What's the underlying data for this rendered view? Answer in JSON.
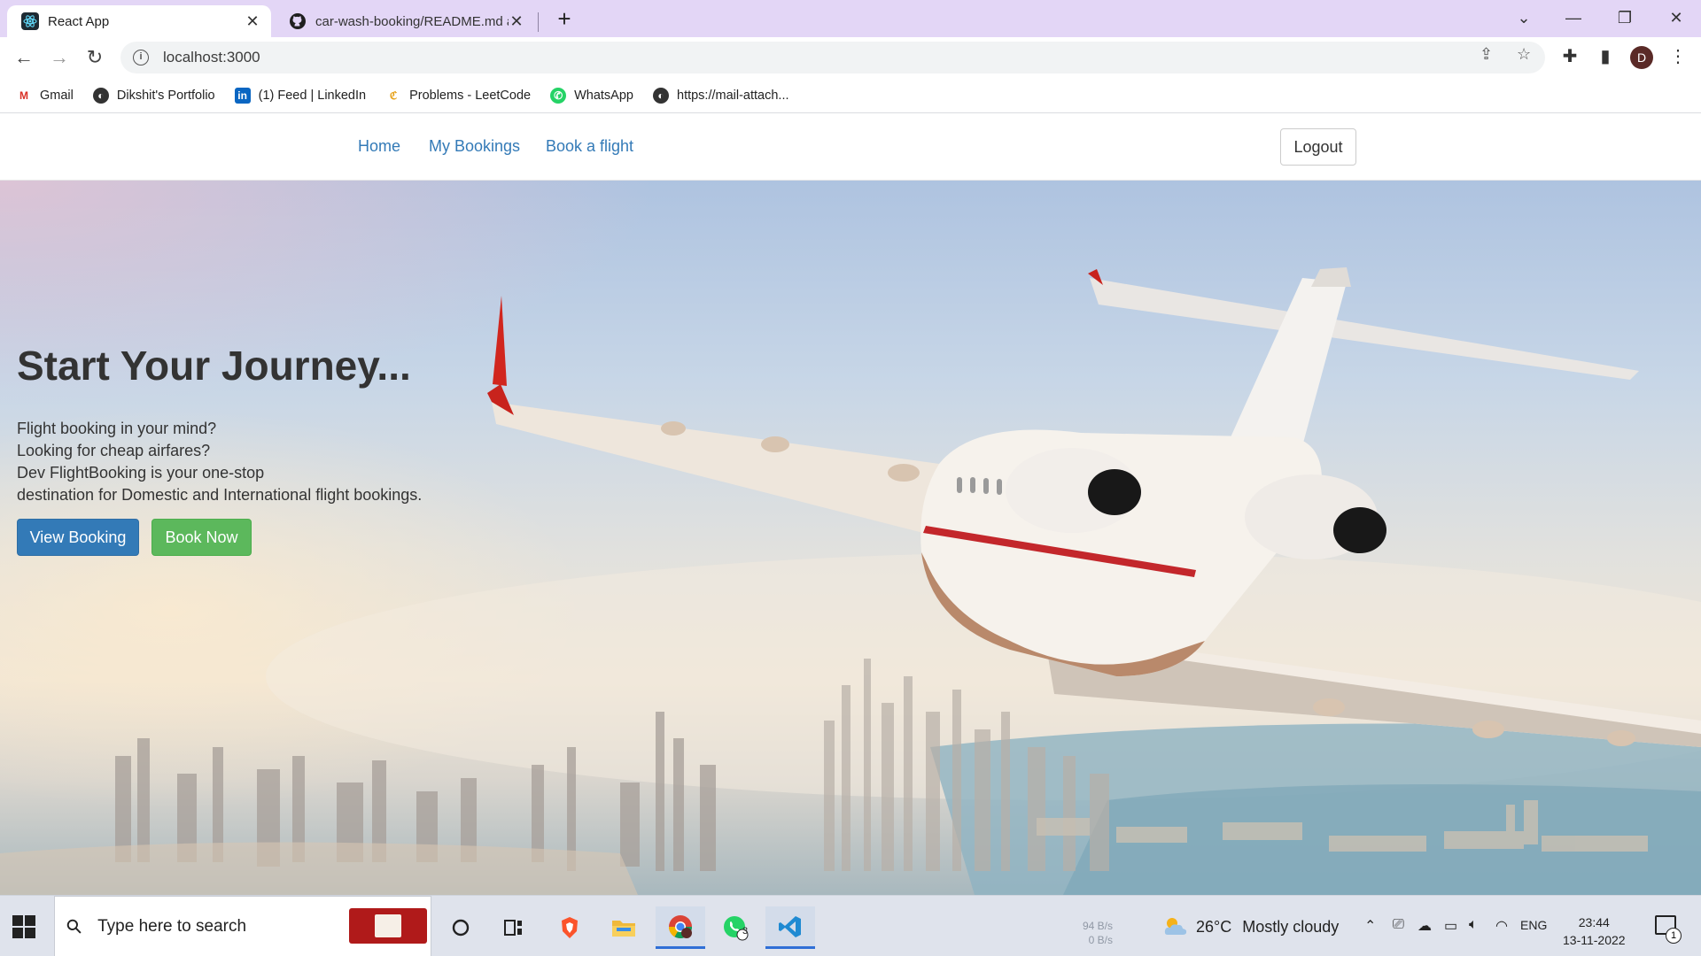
{
  "browser": {
    "tabs": [
      {
        "title": "React App",
        "active": true,
        "icon": "react-icon"
      },
      {
        "title": "car-wash-booking/README.md at",
        "active": false,
        "icon": "github-icon"
      }
    ],
    "new_tab_label": "+",
    "address": "localhost:3000",
    "profile_initial": "D",
    "bookmarks": [
      {
        "label": "Gmail",
        "icon": "gmail-icon"
      },
      {
        "label": "Dikshit's Portfolio",
        "icon": "globe-icon"
      },
      {
        "label": "(1) Feed | LinkedIn",
        "icon": "linkedin-icon"
      },
      {
        "label": "Problems - LeetCode",
        "icon": "leetcode-icon"
      },
      {
        "label": "WhatsApp",
        "icon": "whatsapp-icon"
      },
      {
        "label": "https://mail-attach...",
        "icon": "globe-icon"
      }
    ]
  },
  "navbar": {
    "links": [
      "Home",
      "My Bookings",
      "Book a flight"
    ],
    "logout_label": "Logout"
  },
  "hero": {
    "title": "Start Your Journey...",
    "lines": [
      "Flight booking in your mind?",
      "Looking for cheap airfares?",
      "Dev FlightBooking is your one-stop",
      "destination for Domestic and International flight bookings."
    ],
    "primary_button": "View Booking",
    "secondary_button": "Book Now"
  },
  "taskbar": {
    "search_placeholder": "Type here to search",
    "net_up": "94 B/s",
    "net_down": "0 B/s",
    "temperature": "26°C",
    "weather": "Mostly cloudy",
    "language": "ENG",
    "time": "23:44",
    "date": "13-11-2022",
    "whatsapp_badge": "3",
    "notification_count": "1"
  },
  "colors": {
    "tab_strip": "#e3d6f6",
    "link": "#337ab7",
    "primary": "#337ab7",
    "success": "#5cb85c",
    "taskbar": "#dfe3ec"
  }
}
